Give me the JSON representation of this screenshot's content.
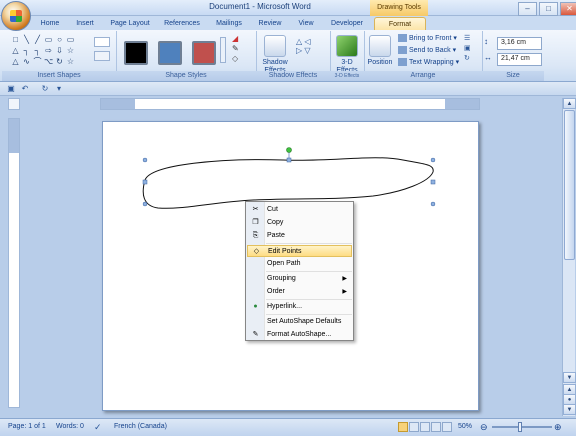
{
  "window": {
    "title": "Document1 - Microsoft Word",
    "contextual_tab_group": "Drawing Tools",
    "controls": [
      "–",
      "□",
      "✕"
    ]
  },
  "tabs": [
    {
      "label": "Home"
    },
    {
      "label": "Insert"
    },
    {
      "label": "Page Layout"
    },
    {
      "label": "References"
    },
    {
      "label": "Mailings"
    },
    {
      "label": "Review"
    },
    {
      "label": "View"
    },
    {
      "label": "Developer"
    },
    {
      "label": "Format",
      "active": true
    }
  ],
  "ribbon": {
    "groups": {
      "insert_shapes": "Insert Shapes",
      "shape_styles": "Shape Styles",
      "shadow_effects": "Shadow Effects",
      "three_d": "3-D Effects",
      "arrange": "Arrange",
      "size": "Size"
    },
    "shape_glyphs": [
      "□",
      "╲",
      "╱",
      "▭",
      "○",
      "▭",
      "△",
      "┐",
      "┐",
      "⇨",
      "⇩",
      "☆",
      "△",
      "∿",
      "⌒",
      "⌥",
      "↻",
      "☆"
    ],
    "style_swatches": [
      {
        "color": "#000000"
      },
      {
        "color": "#4f81bd"
      },
      {
        "color": "#c0504d"
      }
    ],
    "shadow_effects_label": "Shadow Effects",
    "three_d_label": "3-D Effects",
    "position_label": "Position",
    "arrange": {
      "bring_to_front": "Bring to Front",
      "send_to_back": "Send to Back",
      "text_wrapping": "Text Wrapping"
    },
    "size": {
      "height": "3,16 cm",
      "width": "21,47 cm"
    }
  },
  "context_menu": {
    "items": [
      {
        "label": "Cut",
        "icon": "scissors-icon",
        "glyph": "✂"
      },
      {
        "label": "Copy",
        "icon": "copy-icon",
        "glyph": "❐"
      },
      {
        "label": "Paste",
        "icon": "paste-icon",
        "glyph": "⎘"
      },
      {
        "label": "Edit Points",
        "icon": "edit-points-icon",
        "glyph": "◇",
        "highlighted": true
      },
      {
        "label": "Open Path",
        "icon": "",
        "glyph": ""
      },
      {
        "label": "Grouping",
        "icon": "",
        "glyph": "",
        "submenu": true
      },
      {
        "label": "Order",
        "icon": "",
        "glyph": "",
        "submenu": true
      },
      {
        "label": "Hyperlink...",
        "icon": "hyperlink-icon",
        "glyph": "●"
      },
      {
        "label": "Set AutoShape Defaults",
        "icon": "",
        "glyph": ""
      },
      {
        "label": "Format AutoShape...",
        "icon": "format-shape-icon",
        "glyph": "✎"
      }
    ]
  },
  "status": {
    "page": "Page: 1 of 1",
    "words": "Words: 0",
    "language": "French (Canada)",
    "zoom": "50%"
  }
}
